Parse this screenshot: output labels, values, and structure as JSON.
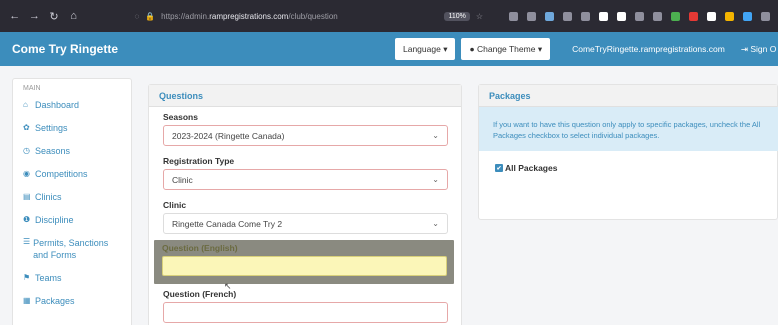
{
  "browser": {
    "url_prefix": "https://admin.",
    "url_host": "rampregistrations.com",
    "url_path": "/club/question",
    "zoom": "110%"
  },
  "app": {
    "brand": "Come Try Ringette",
    "language_btn": "Language",
    "theme_btn": "Change Theme",
    "site_link": "ComeTryRingette.rampregistrations.com",
    "signout": "Sign O"
  },
  "sidebar": {
    "heading": "MAIN",
    "items": [
      {
        "label": "Dashboard",
        "icon": "home-icon"
      },
      {
        "label": "Settings",
        "icon": "gear-icon"
      },
      {
        "label": "Seasons",
        "icon": "clock-icon"
      },
      {
        "label": "Competitions",
        "icon": "globe-icon"
      },
      {
        "label": "Clinics",
        "icon": "book-icon"
      },
      {
        "label": "Discipline",
        "icon": "info-icon"
      },
      {
        "label": "Permits, Sanctions and Forms",
        "icon": "list-icon"
      },
      {
        "label": "Teams",
        "icon": "flag-icon"
      },
      {
        "label": "Packages",
        "icon": "grid-icon"
      }
    ]
  },
  "questions": {
    "title": "Questions",
    "seasons_label": "Seasons",
    "seasons_value": "2023-2024 (Ringette Canada)",
    "regtype_label": "Registration Type",
    "regtype_value": "Clinic",
    "clinic_label": "Clinic",
    "clinic_value": "Ringette Canada Come Try 2",
    "q_en_label": "Question (English)",
    "q_fr_label": "Question (French)"
  },
  "packages": {
    "title": "Packages",
    "info_line1": "If you want to have this question only apply to specific packages, uncheck the All",
    "info_line2": "Packages checkbox to select individual packages.",
    "all_label": "All Packages"
  },
  "colors": {
    "brand": "#3c8dbc",
    "browser": "#2b2a33",
    "highlight": "#fbf6b8"
  }
}
